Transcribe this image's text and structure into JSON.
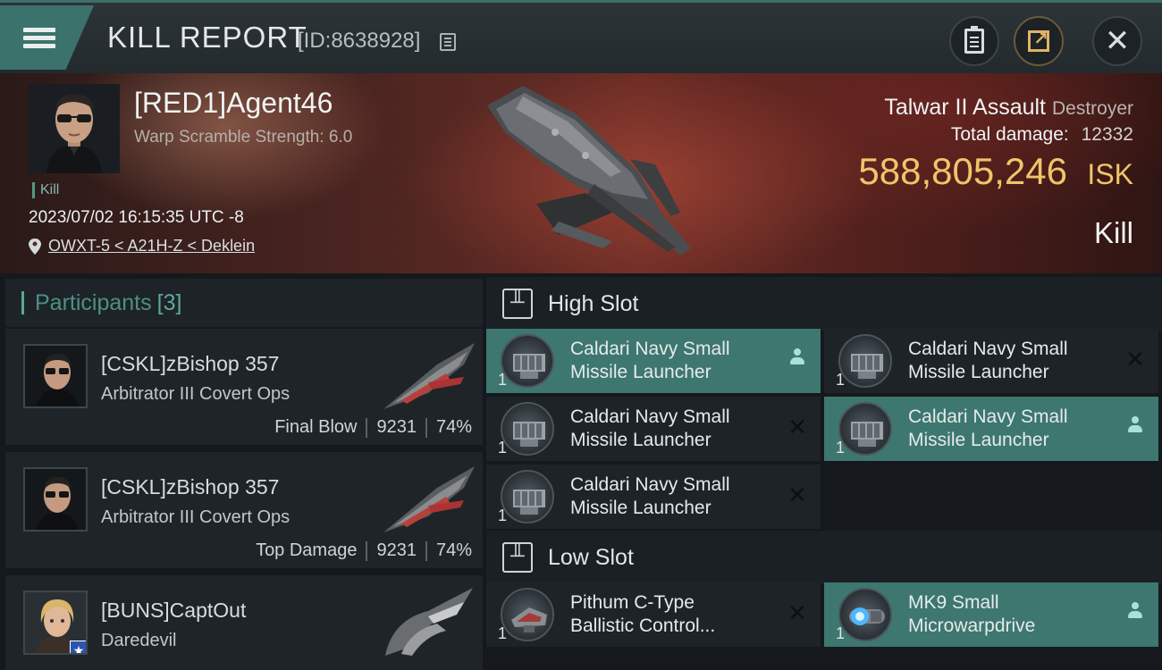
{
  "header": {
    "title": "KILL REPORT",
    "report_id": "[ID:8638928]"
  },
  "victim": {
    "name": "[RED1]Agent46",
    "scramble": "Warp Scramble Strength: 6.0",
    "tag": "Kill",
    "timestamp": "2023/07/02 16:15:35 UTC -8",
    "location": "OWXT-5 < A21H-Z < Deklein",
    "ship_name": "Talwar II Assault",
    "ship_class": "Destroyer",
    "damage_label": "Total damage:",
    "damage_value": "12332",
    "isk_value": "588,805,246",
    "isk_unit": "ISK",
    "result": "Kill"
  },
  "participants": {
    "label": "Participants",
    "count": "[3]",
    "rows": [
      {
        "name": "[CSKL]zBishop 357",
        "ship": "Arbitrator III Covert Ops",
        "role": "Final Blow",
        "damage": "9231",
        "percent": "74%"
      },
      {
        "name": "[CSKL]zBishop 357",
        "ship": "Arbitrator III Covert Ops",
        "role": "Top Damage",
        "damage": "9231",
        "percent": "74%"
      },
      {
        "name": "[BUNS]CaptOut",
        "ship": "Daredevil",
        "role": "",
        "damage": "",
        "percent": ""
      }
    ]
  },
  "high_slot": {
    "title": "High Slot",
    "modules": [
      {
        "qty": "1",
        "name1": "Caldari Navy Small",
        "name2": "Missile Launcher",
        "state": "dropped"
      },
      {
        "qty": "1",
        "name1": "Caldari Navy Small",
        "name2": "Missile Launcher",
        "state": "destroyed"
      },
      {
        "qty": "1",
        "name1": "Caldari Navy Small",
        "name2": "Missile Launcher",
        "state": "destroyed"
      },
      {
        "qty": "1",
        "name1": "Caldari Navy Small",
        "name2": "Missile Launcher",
        "state": "dropped"
      },
      {
        "qty": "1",
        "name1": "Caldari Navy Small",
        "name2": "Missile Launcher",
        "state": "destroyed"
      }
    ]
  },
  "low_slot": {
    "title": "Low Slot",
    "modules": [
      {
        "qty": "1",
        "name1": "Pithum C-Type",
        "name2": "Ballistic Control...",
        "state": "destroyed"
      },
      {
        "qty": "1",
        "name1": "MK9 Small",
        "name2": "Microwarpdrive",
        "state": "dropped"
      }
    ]
  },
  "colors": {
    "accent": "#3b726c",
    "dropped": "#3d776f",
    "isk": "#f0c56a"
  }
}
